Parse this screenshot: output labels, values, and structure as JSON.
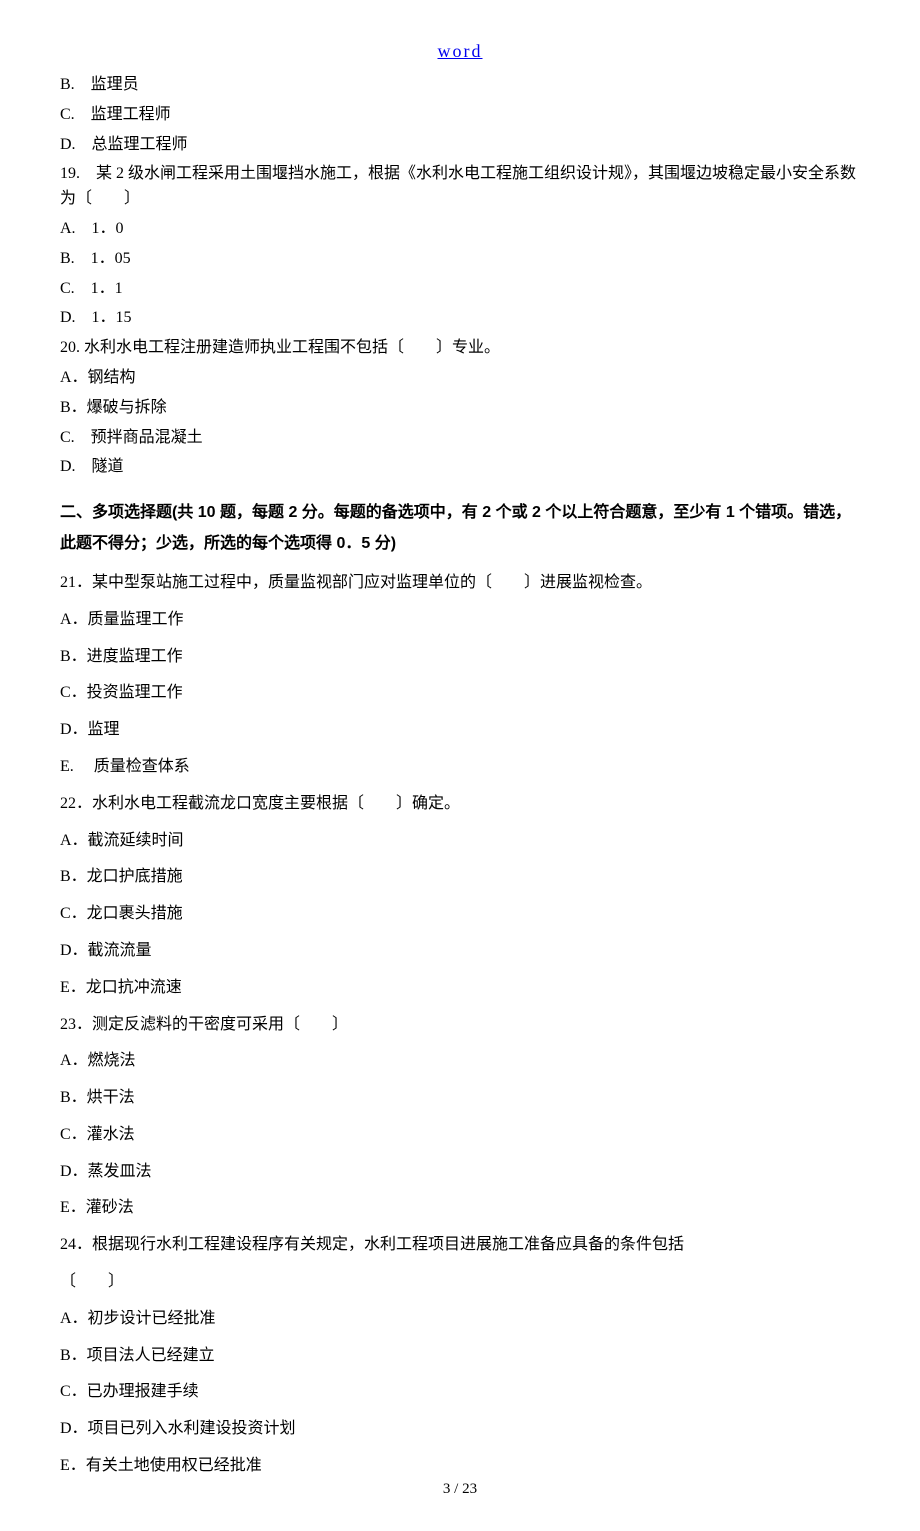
{
  "header": {
    "link": "word"
  },
  "part1": {
    "q18": {
      "optB": "B.　监理员",
      "optC": "C.　监理工程师",
      "optD": "D.　总监理工程师"
    },
    "q19": {
      "text": "19.　某 2 级水闸工程采用土围堰挡水施工，根据《水利水电工程施工组织设计规》，其围堰边坡稳定最小安全系数为〔　　〕",
      "optA": "A.　1．0",
      "optB": "B.　1．05",
      "optC": "C.　1．1",
      "optD": "D.　1．15"
    },
    "q20": {
      "text": "20. 水利水电工程注册建造师执业工程围不包括〔　　〕专业。",
      "optA": "A．钢结构",
      "optB": "B．爆破与拆除",
      "optC": "C.　预拌商品混凝土",
      "optD": "D.　隧道"
    }
  },
  "section2": {
    "title": "二、多项选择题(共 10 题，每题 2 分。每题的备选项中，有 2 个或 2 个以上符合题意，至少有 1 个错项。错选，此题不得分；少选，所选的每个选项得 0．5 分)"
  },
  "part2": {
    "q21": {
      "text": "21．某中型泵站施工过程中，质量监视部门应对监理单位的〔　　〕进展监视检查。",
      "optA": "A．质量监理工作",
      "optB": "B．进度监理工作",
      "optC": "C．投资监理工作",
      "optD": "D．监理",
      "optE": "E. 　质量检查体系"
    },
    "q22": {
      "text": "22．水利水电工程截流龙口宽度主要根据〔　　〕确定。",
      "optA": "A．截流延续时间",
      "optB": "B．龙口护底措施",
      "optC": "C．龙口裹头措施",
      "optD": "D．截流流量",
      "optE": "E．龙口抗冲流速"
    },
    "q23": {
      "text": "23．测定反滤料的干密度可采用〔　　〕",
      "optA": "A．燃烧法",
      "optB": "B．烘干法",
      "optC": "C．灌水法",
      "optD": "D．蒸发皿法",
      "optE": "E．灌砂法"
    },
    "q24": {
      "text": "24．根据现行水利工程建设程序有关规定，水利工程项目进展施工准备应具备的条件包括",
      "text2": "〔　　〕",
      "optA": "A．初步设计已经批准",
      "optB": "B．项目法人已经建立",
      "optC": "C．已办理报建手续",
      "optD": "D．项目已列入水利建设投资计划",
      "optE": "E．有关土地使用权已经批准"
    }
  },
  "footer": {
    "page": "3 / 23"
  }
}
